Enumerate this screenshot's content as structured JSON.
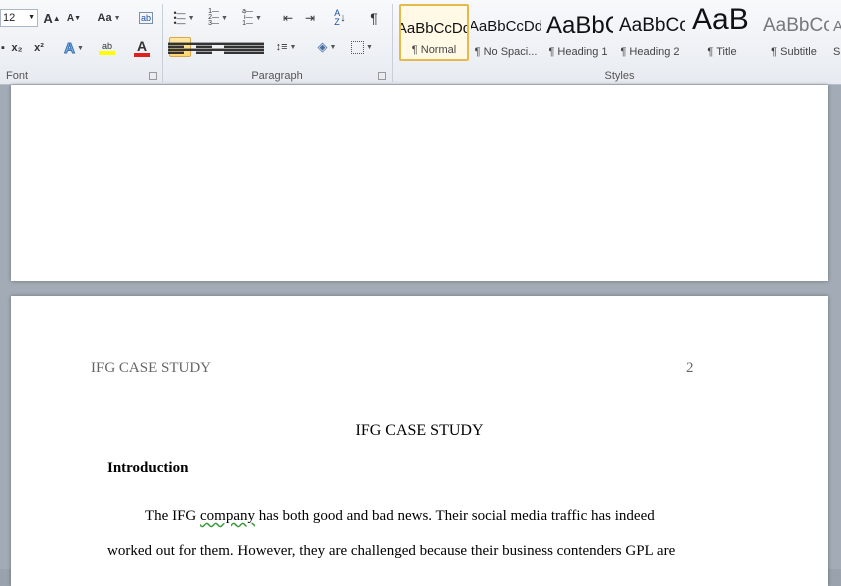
{
  "ribbon": {
    "font_group": {
      "label": "Font",
      "font_size": "12",
      "grow_font": "A",
      "shrink_font": "A",
      "change_case": "Aa",
      "subscript": "x₂",
      "superscript": "x²",
      "text_effects": "A",
      "highlight": "ab",
      "font_color": "A",
      "font_color_swatch": "#e02020",
      "highlight_swatch": "#ffff00"
    },
    "paragraph_group": {
      "label": "Paragraph",
      "show_marks": "¶"
    },
    "styles_group": {
      "label": "Styles",
      "tiles": [
        {
          "sample": "AaBbCcDd",
          "name": "¶ Normal",
          "active": true
        },
        {
          "sample": "AaBbCcDd",
          "name": "¶ No Spaci..."
        },
        {
          "sample": "AaBbCc",
          "name": "¶ Heading 1"
        },
        {
          "sample": "AaBbCc",
          "name": "¶ Heading 2"
        },
        {
          "sample": "AaB",
          "name": "¶ Title"
        },
        {
          "sample": "AaBbCc.",
          "name": "¶ Subtitle"
        },
        {
          "sample": "A",
          "name": "S"
        }
      ]
    },
    "accent_color": "#e5b94a"
  },
  "document": {
    "header_left": "IFG CASE STUDY",
    "page_number": "2",
    "title": "IFG CASE STUDY",
    "intro_heading": "Introduction",
    "line1_pre": "The IFG ",
    "line1_flag": "company",
    "line1_post": " has both good and bad news. Their social media traffic has indeed",
    "line2": "worked out for them. However, they are challenged because their business contenders GPL are"
  }
}
